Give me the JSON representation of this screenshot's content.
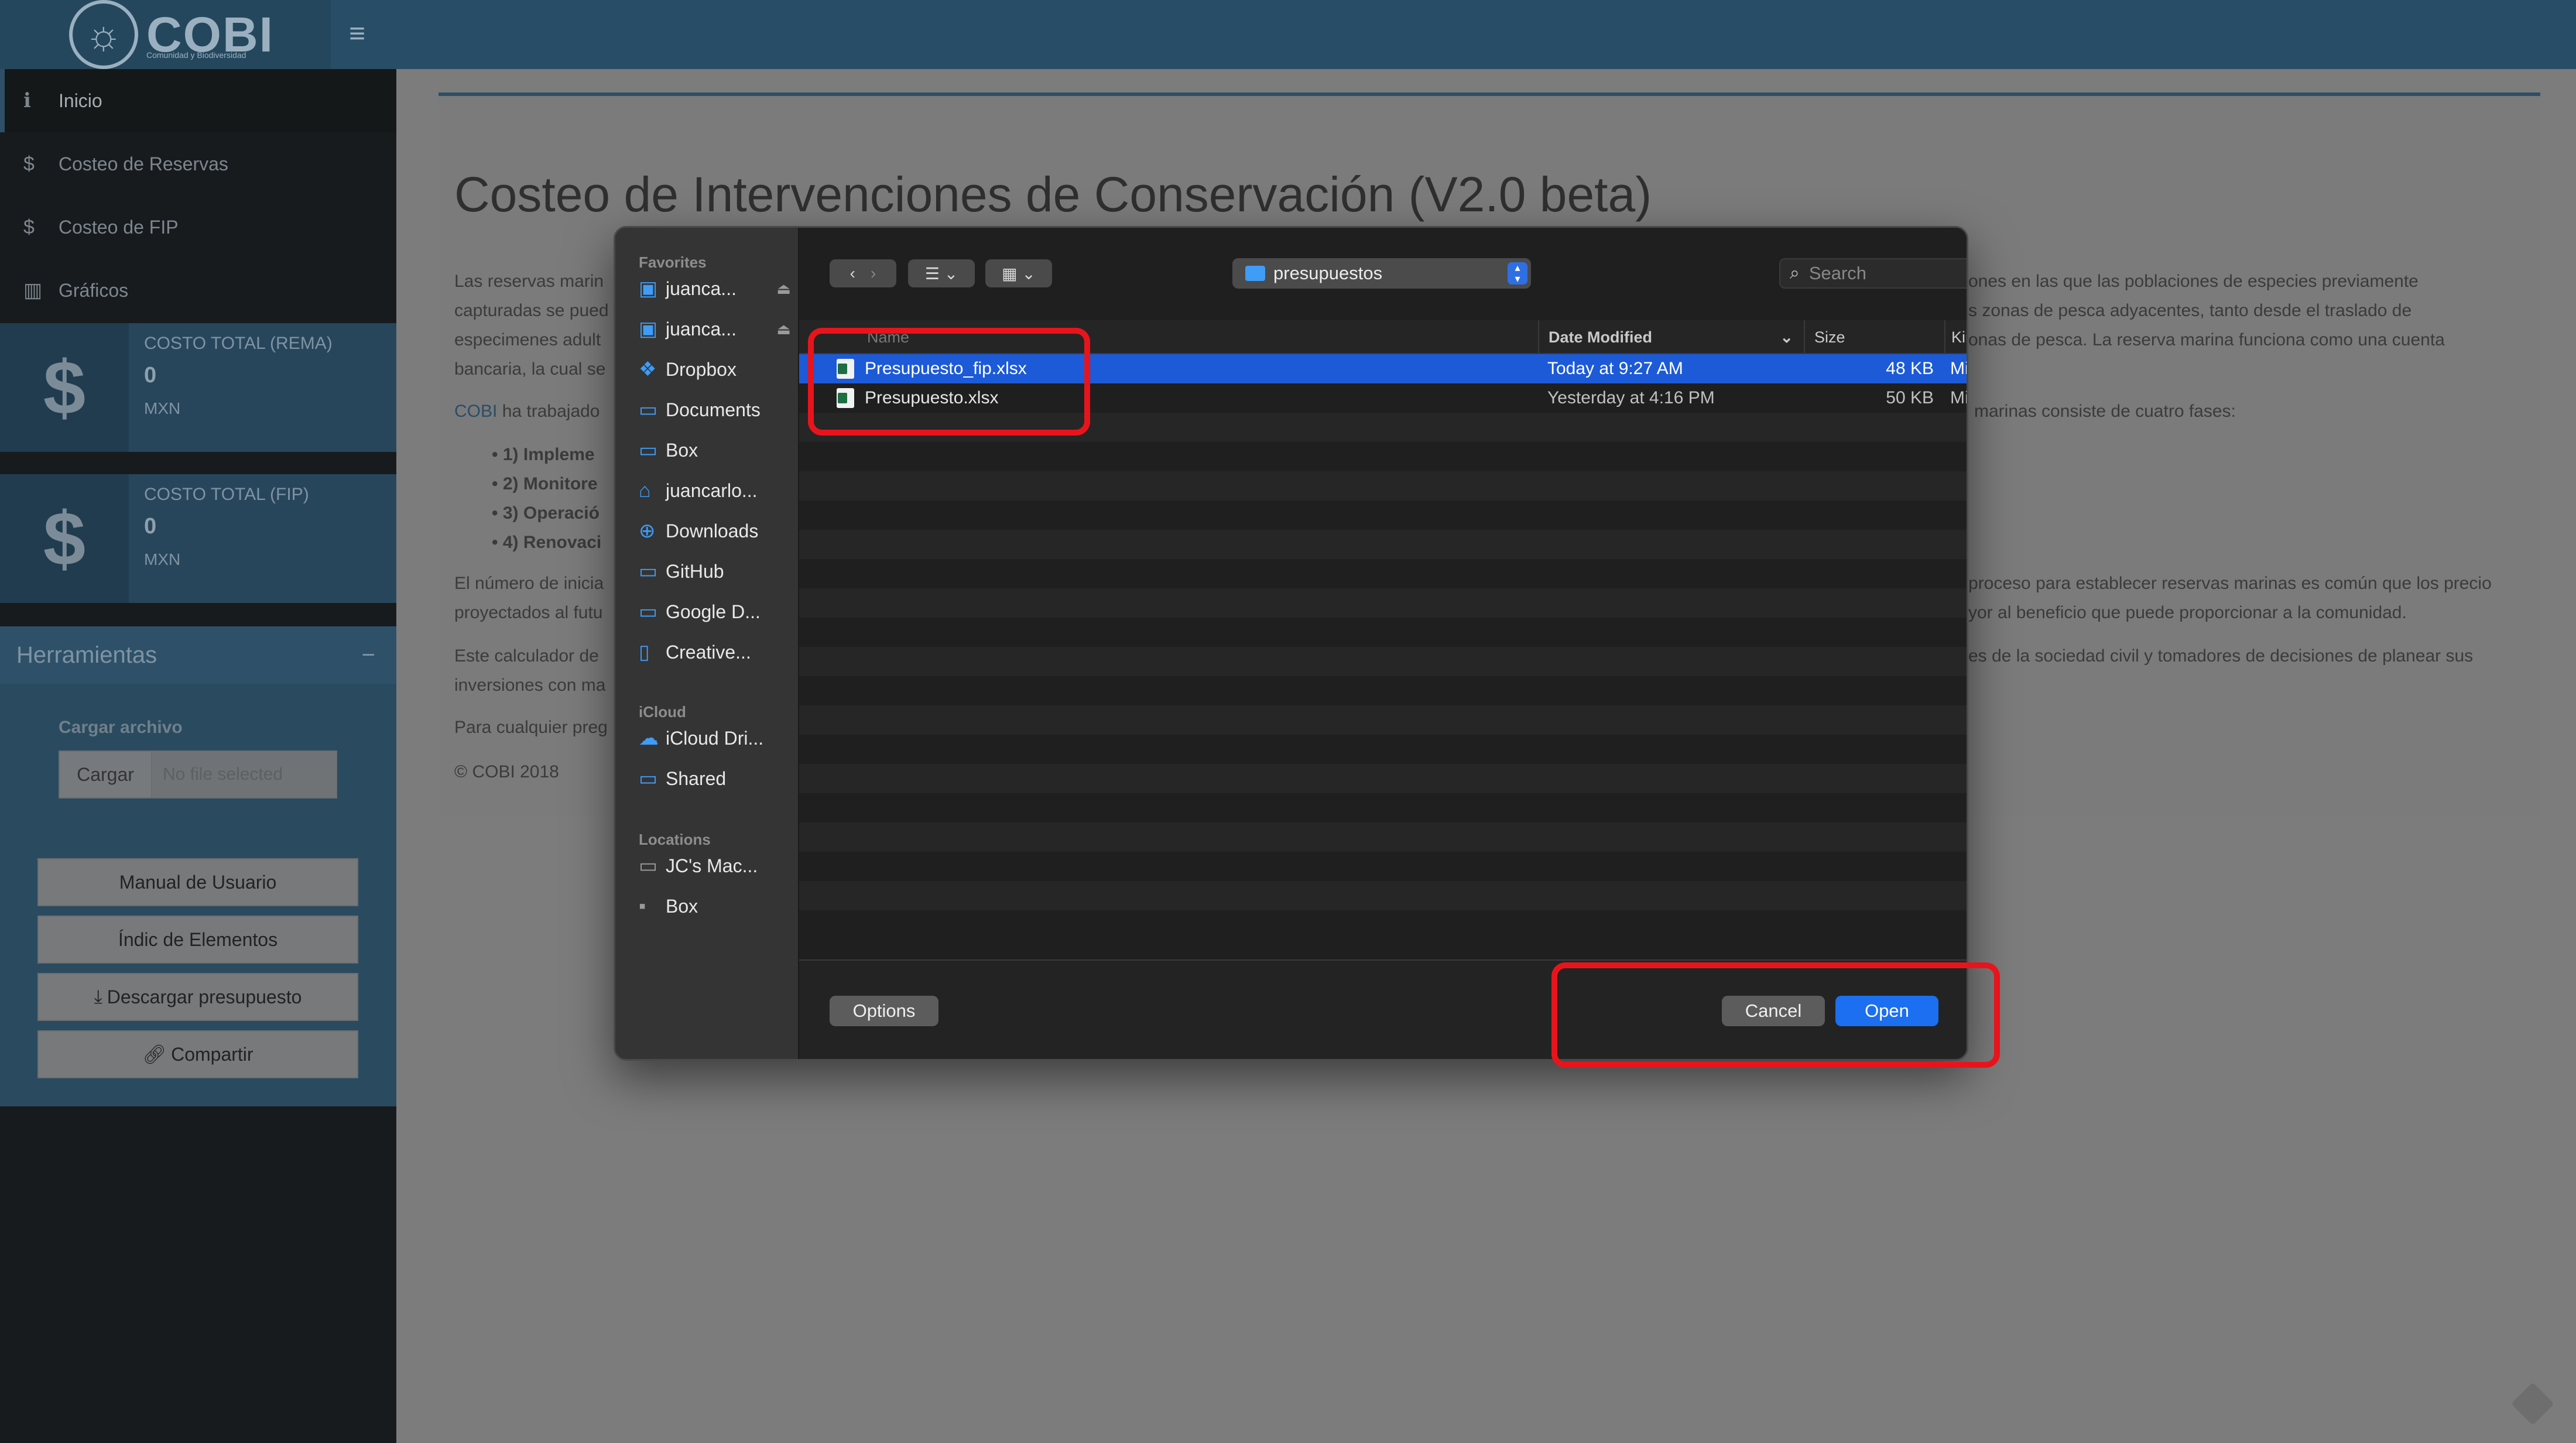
{
  "app": {
    "logo_text": "COBI",
    "logo_subtitle": "Comunidad y Biodiversidad"
  },
  "sidebar": {
    "items": [
      {
        "label": "Inicio",
        "icon": "info-icon"
      },
      {
        "label": "Costeo de Reservas",
        "icon": "dollar-icon"
      },
      {
        "label": "Costeo de FIP",
        "icon": "dollar-icon"
      },
      {
        "label": "Gráficos",
        "icon": "bar-chart-icon"
      }
    ],
    "infoboxes": [
      {
        "title": "COSTO TOTAL (REMA)",
        "value": "0",
        "unit": "MXN"
      },
      {
        "title": "COSTO TOTAL (FIP)",
        "value": "0",
        "unit": "MXN"
      }
    ],
    "tools": {
      "title": "Herramientas",
      "collapse": "−",
      "upload_label": "Cargar archivo",
      "upload_button": "Cargar",
      "upload_value": "No file selected",
      "buttons": [
        "Manual de Usuario",
        "Índic de Elementos",
        "Descargar presupuesto",
        "Compartir"
      ]
    }
  },
  "page": {
    "title": "Costeo de Intervenciones de Conservación (V2.0 beta)",
    "paragraphs_left": [
      "Las reservas marin",
      "capturadas se pued",
      "especimenes adult",
      "bancaria, la cual se"
    ],
    "paragraphs_right": [
      "ones en las que las poblaciones de especies previamente",
      "s zonas de pesca adyacentes, tanto desde el traslado de",
      "onas de pesca. La reserva marina funciona como una cuenta"
    ],
    "cobi_link": "COBI",
    "cobi_text": " ha trabajado ",
    "phases_right": "marinas consiste de cuatro fases:",
    "phases": [
      "1) Impleme",
      "2) Monitore",
      "3) Operació",
      "4) Renovaci"
    ],
    "numero_left": [
      "El número de inicia",
      "proyectados al futu"
    ],
    "numero_right": [
      "proceso para establecer reservas marinas es común que los precio",
      "yor al beneficio que puede proporcionar a la comunidad."
    ],
    "calc_left": [
      "Este calculador de",
      "inversiones con ma"
    ],
    "calc_right": [
      "es de la sociedad civil y tomadores de decisiones de planear sus"
    ],
    "contact_left": "Para cualquier preg",
    "footer": "© COBI 2018"
  },
  "dialog": {
    "sidebar": {
      "favorites_title": "Favorites",
      "favorites": [
        {
          "label": "juanca...",
          "icon": "drive-icon",
          "eject": "⏏"
        },
        {
          "label": "juanca...",
          "icon": "drive-icon",
          "eject": "⏏"
        },
        {
          "label": "Dropbox",
          "icon": "dropbox-icon"
        },
        {
          "label": "Documents",
          "icon": "folder-icon"
        },
        {
          "label": "Box",
          "icon": "folder-icon"
        },
        {
          "label": "juancarlo...",
          "icon": "home-icon"
        },
        {
          "label": "Downloads",
          "icon": "download-icon"
        },
        {
          "label": "GitHub",
          "icon": "folder-icon"
        },
        {
          "label": "Google D...",
          "icon": "folder-icon"
        },
        {
          "label": "Creative...",
          "icon": "document-icon"
        }
      ],
      "icloud_title": "iCloud",
      "icloud": [
        {
          "label": "iCloud Dri...",
          "icon": "cloud-icon"
        },
        {
          "label": "Shared",
          "icon": "shared-folder-icon"
        }
      ],
      "locations_title": "Locations",
      "locations": [
        {
          "label": "JC's Mac...",
          "icon": "laptop-icon"
        },
        {
          "label": "Box",
          "icon": "disk-icon"
        }
      ]
    },
    "toolbar": {
      "path": "presupuestos",
      "search_placeholder": "Search"
    },
    "columns": [
      "Name",
      "Date Modified",
      "Size",
      "Kind"
    ],
    "files": [
      {
        "name": "Presupuesto_fip.xlsx",
        "date": "Today at 9:27 AM",
        "size": "48 KB",
        "kind": "Mic",
        "selected": true
      },
      {
        "name": "Presupuesto.xlsx",
        "date": "Yesterday at 4:16 PM",
        "size": "50 KB",
        "kind": "Mic",
        "selected": false
      }
    ],
    "buttons": {
      "options": "Options",
      "cancel": "Cancel",
      "open": "Open"
    }
  },
  "colors": {
    "accent_blue": "#1b6ff0",
    "selection": "#1c5ad8",
    "annotation_red": "#e8141c"
  }
}
